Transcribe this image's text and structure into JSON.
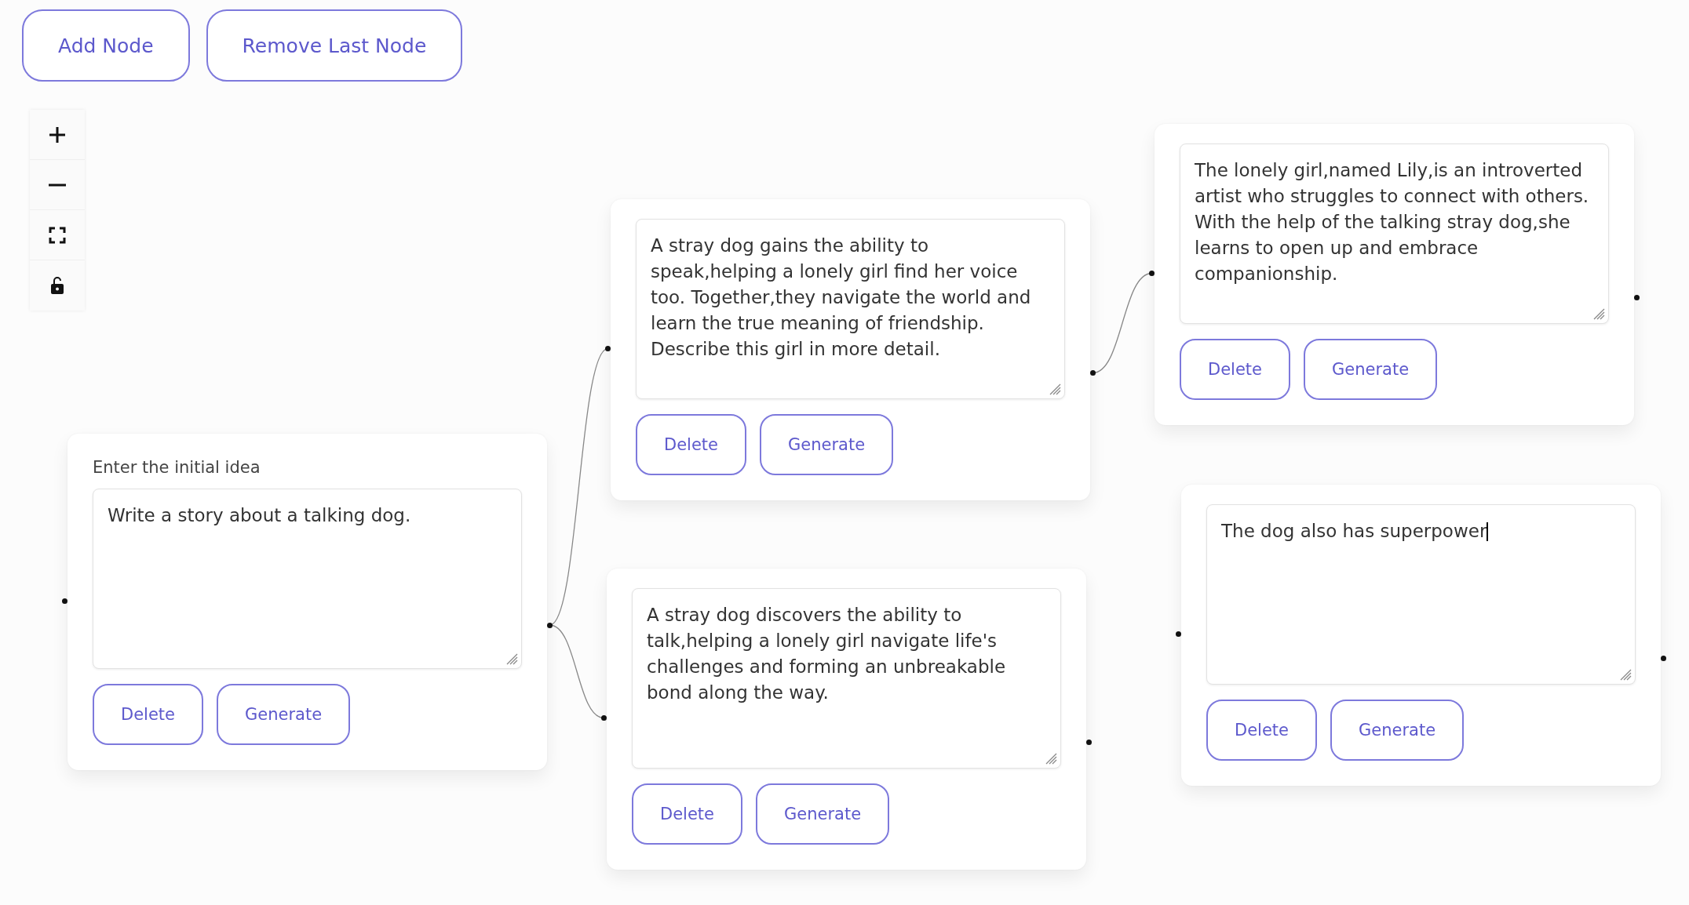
{
  "toolbar": {
    "buttons": [
      "Add Node",
      "Remove Last Node"
    ]
  },
  "nodes": [
    {
      "label": "Enter the initial idea",
      "text": "Write a story about a talking dog.",
      "focused": false,
      "buttons": [
        "Delete",
        "Generate"
      ],
      "children": [
        {
          "text": "A stray dog gains the ability to speak,helping a lonely girl find her voice too. Together,they navigate the world and learn the true meaning of friendship. Describe this girl in more detail.",
          "focused": false,
          "buttons": [
            "Delete",
            "Generate"
          ],
          "children": [
            {
              "text": "The lonely girl,named Lily,is an introverted artist who struggles to connect with others. With the help of the talking stray dog,she learns to open up and embrace companionship.",
              "focused": false,
              "buttons": [
                "Delete",
                "Generate"
              ]
            }
          ]
        },
        {
          "text": "A stray dog discovers the ability to talk,helping a lonely girl navigate life's challenges and forming an unbreakable bond along the way.",
          "focused": false,
          "buttons": [
            "Delete",
            "Generate"
          ]
        }
      ]
    },
    {
      "text": "The dog also has superpower",
      "focused": true,
      "buttons": [
        "Delete",
        "Generate"
      ]
    }
  ]
}
